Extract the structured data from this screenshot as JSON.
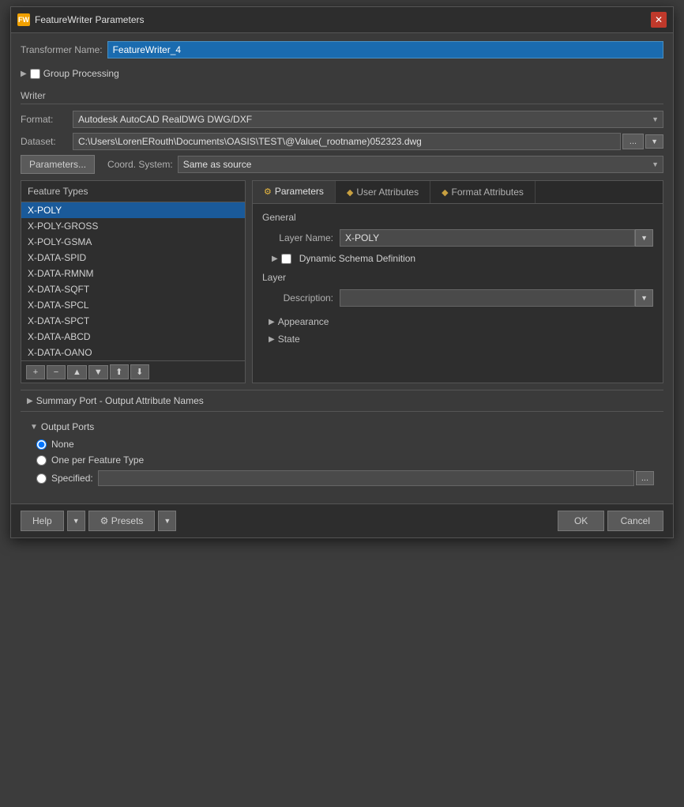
{
  "dialog": {
    "title": "FeatureWriter Parameters",
    "close_label": "✕"
  },
  "transformer": {
    "name_label": "Transformer Name:",
    "name_value": "FeatureWriter_4"
  },
  "group_processing": {
    "arrow": "▶",
    "label": "Group Processing"
  },
  "writer_section": {
    "header": "Writer",
    "format_label": "Format:",
    "format_value": "Autodesk AutoCAD RealDWG DWG/DXF",
    "dataset_label": "Dataset:",
    "dataset_value": "C:\\Users\\LorenERouth\\Documents\\OASIS\\TEST\\@Value(_rootname)052323.dwg",
    "browse_btn": "...",
    "params_btn": "Parameters...",
    "coord_label": "Coord. System:",
    "coord_value": "Same as source"
  },
  "feature_types": {
    "header": "Feature Types",
    "items": [
      "X-POLY",
      "X-POLY-GROSS",
      "X-POLY-GSMA",
      "X-DATA-SPID",
      "X-DATA-RMNM",
      "X-DATA-SQFT",
      "X-DATA-SPCL",
      "X-DATA-SPCT",
      "X-DATA-ABCD",
      "X-DATA-OANO"
    ],
    "selected_index": 0,
    "toolbar": {
      "add": "+",
      "remove": "−",
      "up": "▲",
      "down": "▼",
      "up2": "⬆",
      "down2": "⬇"
    }
  },
  "right_panel": {
    "tabs": [
      {
        "id": "parameters",
        "icon": "⚙",
        "label": "Parameters",
        "active": true
      },
      {
        "id": "user_attributes",
        "icon": "◆",
        "label": "User Attributes",
        "active": false
      },
      {
        "id": "format_attributes",
        "icon": "◆",
        "label": "Format Attributes",
        "active": false
      }
    ],
    "general_label": "General",
    "layer_name_label": "Layer Name:",
    "layer_name_value": "X-POLY",
    "dynamic_schema_label": "Dynamic Schema Definition",
    "layer_label": "Layer",
    "description_label": "Description:",
    "description_value": "",
    "appearance_label": "Appearance",
    "state_label": "State"
  },
  "summary_port": {
    "arrow": "▶",
    "label": "Summary Port - Output Attribute Names"
  },
  "output_ports": {
    "arrow": "▼",
    "header": "Output Ports",
    "none_label": "None",
    "one_per_label": "One per Feature Type",
    "specified_label": "Specified:",
    "specified_value": "",
    "specified_btn": "..."
  },
  "footer": {
    "help_label": "Help",
    "presets_label": "Presets",
    "ok_label": "OK",
    "cancel_label": "Cancel"
  }
}
